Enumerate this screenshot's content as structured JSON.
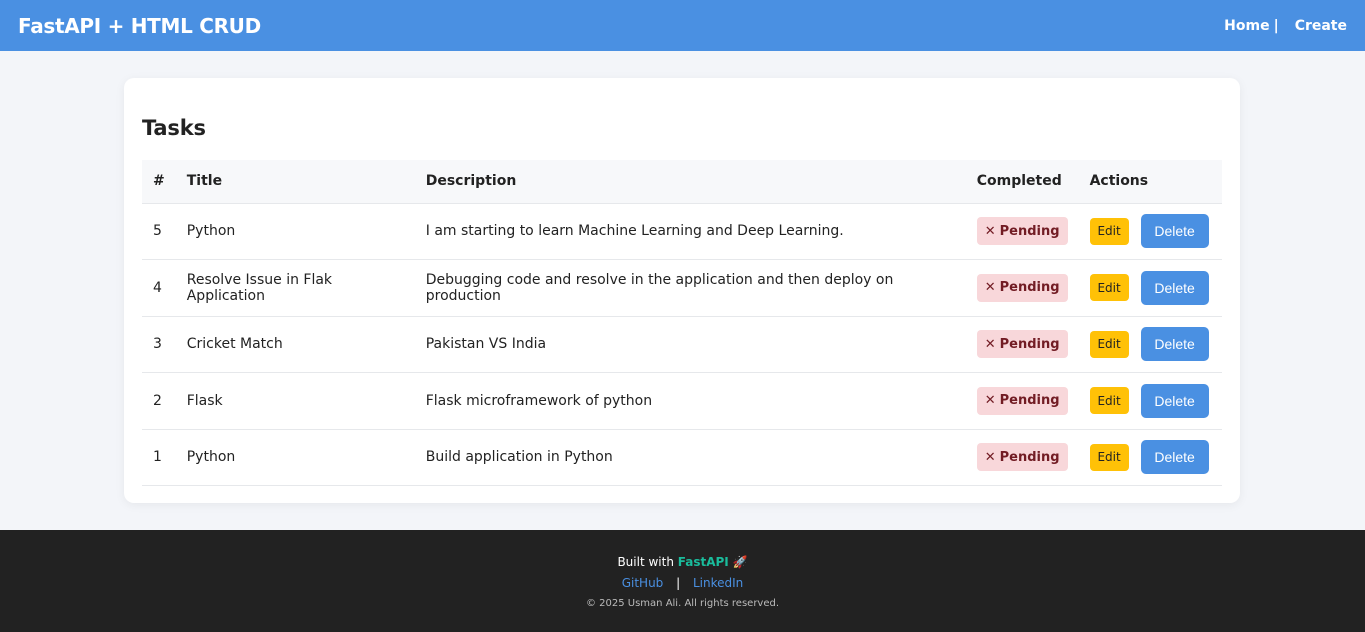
{
  "navbar": {
    "brand": "FastAPI + HTML CRUD",
    "links": [
      {
        "label": "Home"
      },
      {
        "label": "Create"
      }
    ],
    "separator": "|"
  },
  "tasks_card": {
    "heading": "Tasks",
    "columns": [
      "#",
      "Title",
      "Description",
      "Completed",
      "Actions"
    ],
    "rows": [
      {
        "id": "5",
        "title": "Python",
        "description": "I am starting to learn Machine Learning and Deep Learning.",
        "status": "Pending"
      },
      {
        "id": "4",
        "title": "Resolve Issue in Flak Application",
        "description": "Debugging code and resolve in the application and then deploy on production",
        "status": "Pending"
      },
      {
        "id": "3",
        "title": "Cricket Match",
        "description": "Pakistan VS India",
        "status": "Pending"
      },
      {
        "id": "2",
        "title": "Flask",
        "description": "Flask microframework of python",
        "status": "Pending"
      },
      {
        "id": "1",
        "title": "Python",
        "description": "Build application in Python",
        "status": "Pending"
      }
    ],
    "status_icon": "✕",
    "edit_label": "Edit",
    "delete_label": "Delete"
  },
  "footer": {
    "built_with": "Built with",
    "framework": "FastAPI",
    "rocket": "🚀",
    "links": [
      {
        "label": "GitHub"
      },
      {
        "label": "LinkedIn"
      }
    ],
    "separator": "|",
    "copyright": "© 2025 Usman Ali. All rights reserved."
  },
  "colors": {
    "navbar": "#4a90e2",
    "pending_bg": "#f8d7da",
    "pending_text": "#721c24",
    "edit_button": "#ffc107",
    "delete_button": "#4a90e2",
    "footer_bg": "#222222",
    "footer_brand": "#1abc9c"
  }
}
